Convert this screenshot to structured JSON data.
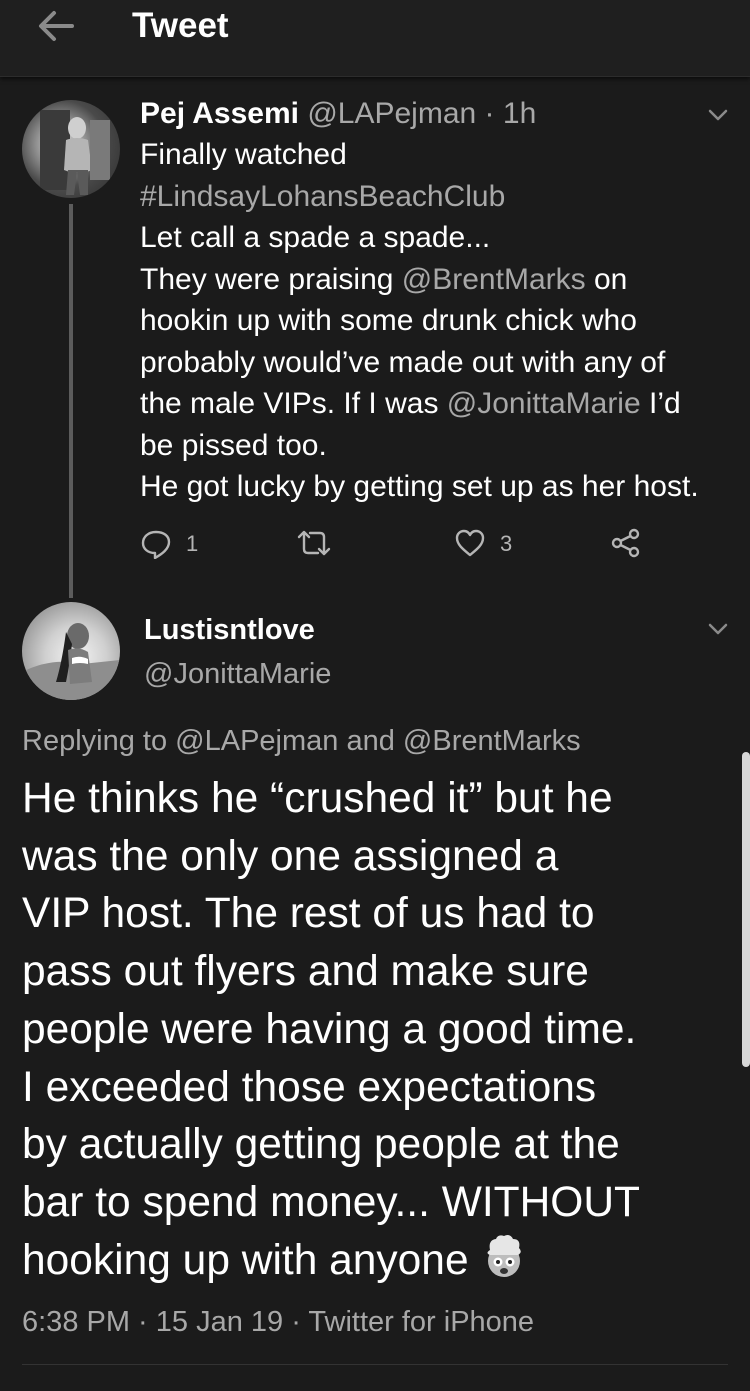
{
  "header": {
    "title": "Tweet",
    "back_icon": "arrow-left-icon"
  },
  "tweet1": {
    "name": "Pej Assemi",
    "handle": "@LAPejman",
    "separator": "·",
    "time": "1h",
    "lines": {
      "l1": "Finally watched",
      "hashtag": "#LindsayLohansBeachClub",
      "l3": "Let call a spade a spade...",
      "l4_pre": "They were praising ",
      "l4_mention": "@BrentMarks",
      "l4_post": " on",
      "l5": "hookin up with some drunk chick who",
      "l6": "probably would’ve made out with any of",
      "l7_pre": "the male VIPs. If I was ",
      "l7_mention": "@JonittaMarie",
      "l7_post": " I’d",
      "l8": "be pissed too.",
      "l9": "He got lucky by getting set up as her host."
    },
    "actions": {
      "reply_count": "1",
      "retweet_count": "",
      "like_count": "3"
    }
  },
  "tweet2": {
    "name": "Lustisntlove",
    "handle": "@JonittaMarie",
    "replying_prefix": "Replying to ",
    "replying_user1": "@LAPejman",
    "replying_and": " and ",
    "replying_user2": "@BrentMarks",
    "lines": {
      "l1": "He thinks he “crushed it” but he",
      "l2": "was the only one assigned a",
      "l3": "VIP host. The rest of us had to",
      "l4": "pass out flyers and make sure",
      "l5": "people were having a good time.",
      "l6": "I exceeded those expectations",
      "l7": "by actually getting people at the",
      "l8": "bar to spend money... WITHOUT",
      "l9": "hooking up with anyone "
    },
    "emoji": "exploding-head-emoji",
    "meta": "6:38 PM · 15 Jan 19 · Twitter for iPhone"
  },
  "colors": {
    "background": "#1b1b1b",
    "topbar": "#1f1f1f",
    "muted_text": "#a8a8a8",
    "primary_text": "#ffffff"
  }
}
